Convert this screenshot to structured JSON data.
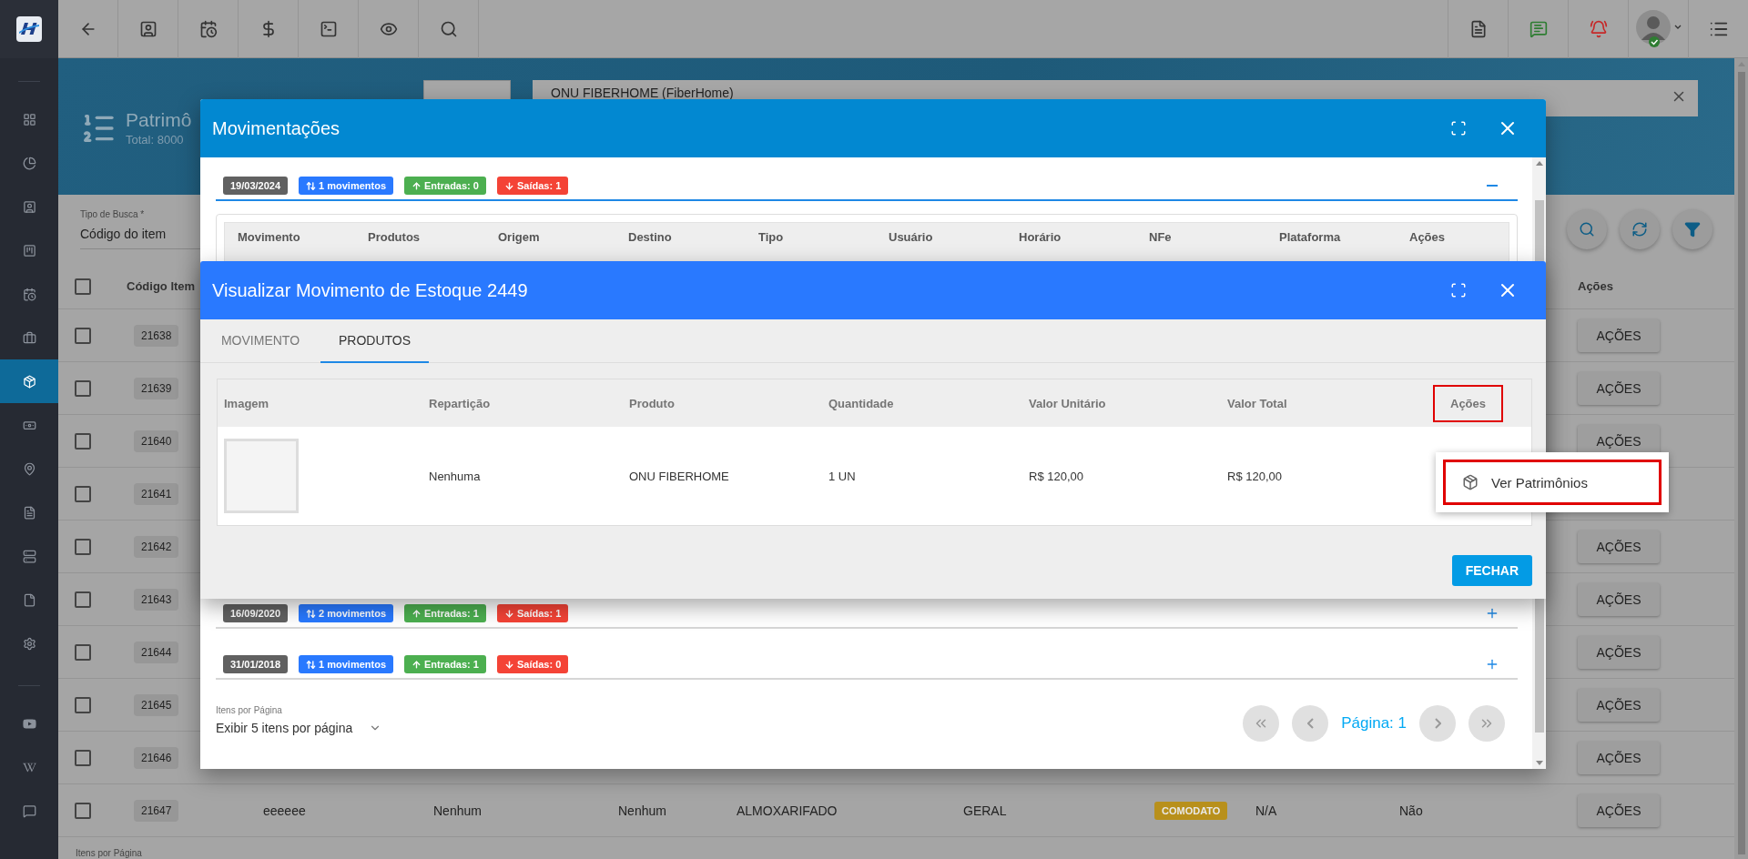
{
  "sidebar": {
    "items": [
      {
        "selected": false
      },
      {
        "selected": false
      },
      {
        "selected": false
      },
      {
        "selected": false
      },
      {
        "selected": false
      },
      {
        "selected": false
      },
      {
        "selected": true
      },
      {
        "selected": false
      },
      {
        "selected": false
      },
      {
        "selected": false
      },
      {
        "selected": false
      },
      {
        "selected": false
      },
      {
        "selected": false
      },
      {
        "selected": false
      },
      {
        "selected": false
      },
      {
        "selected": false
      }
    ]
  },
  "page": {
    "title": "Patrimô",
    "total": "Total: 8000",
    "product_search": {
      "value": "ONU FIBERHOME  (FiberHome)"
    },
    "search_type": {
      "label": "Tipo de Busca *",
      "value": "Código do item"
    },
    "table": {
      "all_checked": false,
      "columns": [
        "Código Item",
        "Ações"
      ],
      "rows": [
        {
          "code": "21638",
          "checked": false,
          "action": "AÇÕES"
        },
        {
          "code": "21639",
          "checked": false,
          "action": "AÇÕES"
        },
        {
          "code": "21640",
          "checked": false,
          "action": "AÇÕES"
        },
        {
          "code": "21641",
          "checked": false
        },
        {
          "code": "21642",
          "checked": false,
          "action": "AÇÕES"
        },
        {
          "code": "21643",
          "checked": false,
          "action": "AÇÕES"
        },
        {
          "code": "21644",
          "checked": false,
          "action": "AÇÕES"
        },
        {
          "code": "21645",
          "checked": false,
          "action": "AÇÕES"
        },
        {
          "code": "21646",
          "checked": false,
          "action": "AÇÕES"
        },
        {
          "code": "21647",
          "checked": false,
          "action": "AÇÕES",
          "cells": [
            {
              "kind": "text",
              "text": "eeeeee"
            },
            {
              "kind": "text",
              "text": "Nenhum"
            },
            {
              "kind": "text",
              "text": "Nenhum"
            },
            {
              "kind": "text",
              "text": "ALMOXARIFADO"
            },
            {
              "kind": "text",
              "text": "GERAL"
            },
            {
              "kind": "tag",
              "text": "COMODATO"
            },
            {
              "kind": "text",
              "text": "N/A"
            },
            {
              "kind": "text",
              "text": "Não"
            }
          ]
        }
      ]
    },
    "page_size_label": "Itens por Página"
  },
  "movements_dialog": {
    "title": "Movimentações",
    "groups": [
      {
        "expanded": true,
        "chips": [
          {
            "kind": "date",
            "text": "19/03/2024"
          },
          {
            "kind": "movements",
            "text": "1 movimentos"
          },
          {
            "kind": "entries",
            "text": "Entradas: 0"
          },
          {
            "kind": "exits",
            "text": "Saídas: 1"
          }
        ],
        "columns": [
          "Movimento",
          "Produtos",
          "Origem",
          "Destino",
          "Tipo",
          "Usuário",
          "Horário",
          "NFe",
          "Plataforma",
          "Ações"
        ]
      },
      {
        "expanded": false,
        "chips": [
          {
            "kind": "date",
            "text": "16/09/2020"
          },
          {
            "kind": "movements",
            "text": "2 movimentos"
          },
          {
            "kind": "entries",
            "text": "Entradas: 1"
          },
          {
            "kind": "exits",
            "text": "Saídas: 1"
          }
        ]
      },
      {
        "expanded": false,
        "chips": [
          {
            "kind": "date",
            "text": "31/01/2018"
          },
          {
            "kind": "movements",
            "text": "1 movimentos"
          },
          {
            "kind": "entries",
            "text": "Entradas: 1"
          },
          {
            "kind": "exits",
            "text": "Saídas: 0"
          }
        ]
      }
    ],
    "page_size": {
      "label": "Itens por Página",
      "value": "Exibir 5 itens por página"
    },
    "pagination": {
      "page": "Página: 1"
    }
  },
  "movement_dialog": {
    "title": "Visualizar Movimento de Estoque 2449",
    "tabs": [
      {
        "label": "MOVIMENTO",
        "selected": false
      },
      {
        "label": "PRODUTOS",
        "selected": true
      }
    ],
    "columns": [
      {
        "label": "Imagem",
        "highlighted": false
      },
      {
        "label": "Repartição",
        "highlighted": false
      },
      {
        "label": "Produto",
        "highlighted": false
      },
      {
        "label": "Quantidade",
        "highlighted": false
      },
      {
        "label": "Valor Unitário",
        "highlighted": false
      },
      {
        "label": "Valor Total",
        "highlighted": false
      },
      {
        "label": "Ações",
        "highlighted": true
      }
    ],
    "rows": [
      {
        "distribution": "Nenhuma",
        "product": "ONU FIBERHOME",
        "quantity": "1 UN",
        "unit_price": "R$ 120,00",
        "total": "R$ 120,00"
      }
    ],
    "close_button": "FECHAR"
  },
  "actions_menu": {
    "items": [
      {
        "label": "Ver Patrimônios",
        "highlighted": true
      }
    ]
  }
}
